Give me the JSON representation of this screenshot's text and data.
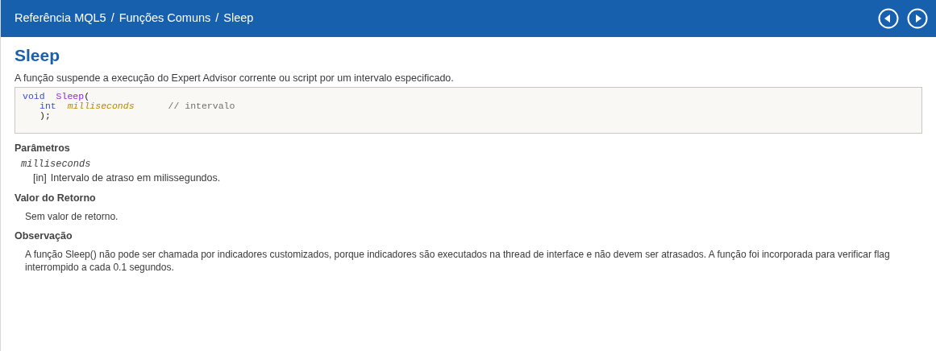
{
  "header": {
    "breadcrumb": [
      "Referência MQL5",
      "Funções Comuns",
      "Sleep"
    ],
    "separator": "/",
    "nav_buttons": [
      {
        "kind": "prev"
      },
      {
        "kind": "next"
      }
    ]
  },
  "title": "Sleep",
  "description": "A função suspende a execução do Expert Advisor corrente ou script por um intervalo especificado.",
  "code": {
    "lines": [
      {
        "tokens": [
          {
            "text": "void",
            "kind": "keyword"
          },
          {
            "text": "Sleep",
            "kind": "function"
          },
          {
            "text": "(",
            "kind": "punct"
          }
        ],
        "children": [
          {
            "tokens": [
              {
                "text": "int",
                "kind": "keyword"
              },
              {
                "text": "milliseconds",
                "kind": "param"
              },
              {
                "text": "// intervalo",
                "kind": "comment"
              }
            ]
          },
          {
            "tokens": [
              {
                "text": ");",
                "kind": "punct"
              }
            ]
          }
        ]
      }
    ]
  },
  "sections": [
    {
      "heading": "Parâmetros",
      "params": [
        {
          "name": "milliseconds",
          "direction": "[in]",
          "text": "Intervalo de atraso em milissegundos."
        }
      ]
    },
    {
      "heading": "Valor do Retorno",
      "text": "Sem valor de retorno."
    },
    {
      "heading": "Observação",
      "text": "A função Sleep() não pode ser chamada por indicadores customizados, porque indicadores são executados na thread de interface e não devem ser atrasados. A função foi incorporada para verificar flag interrompido a cada 0.1 segundos."
    }
  ]
}
